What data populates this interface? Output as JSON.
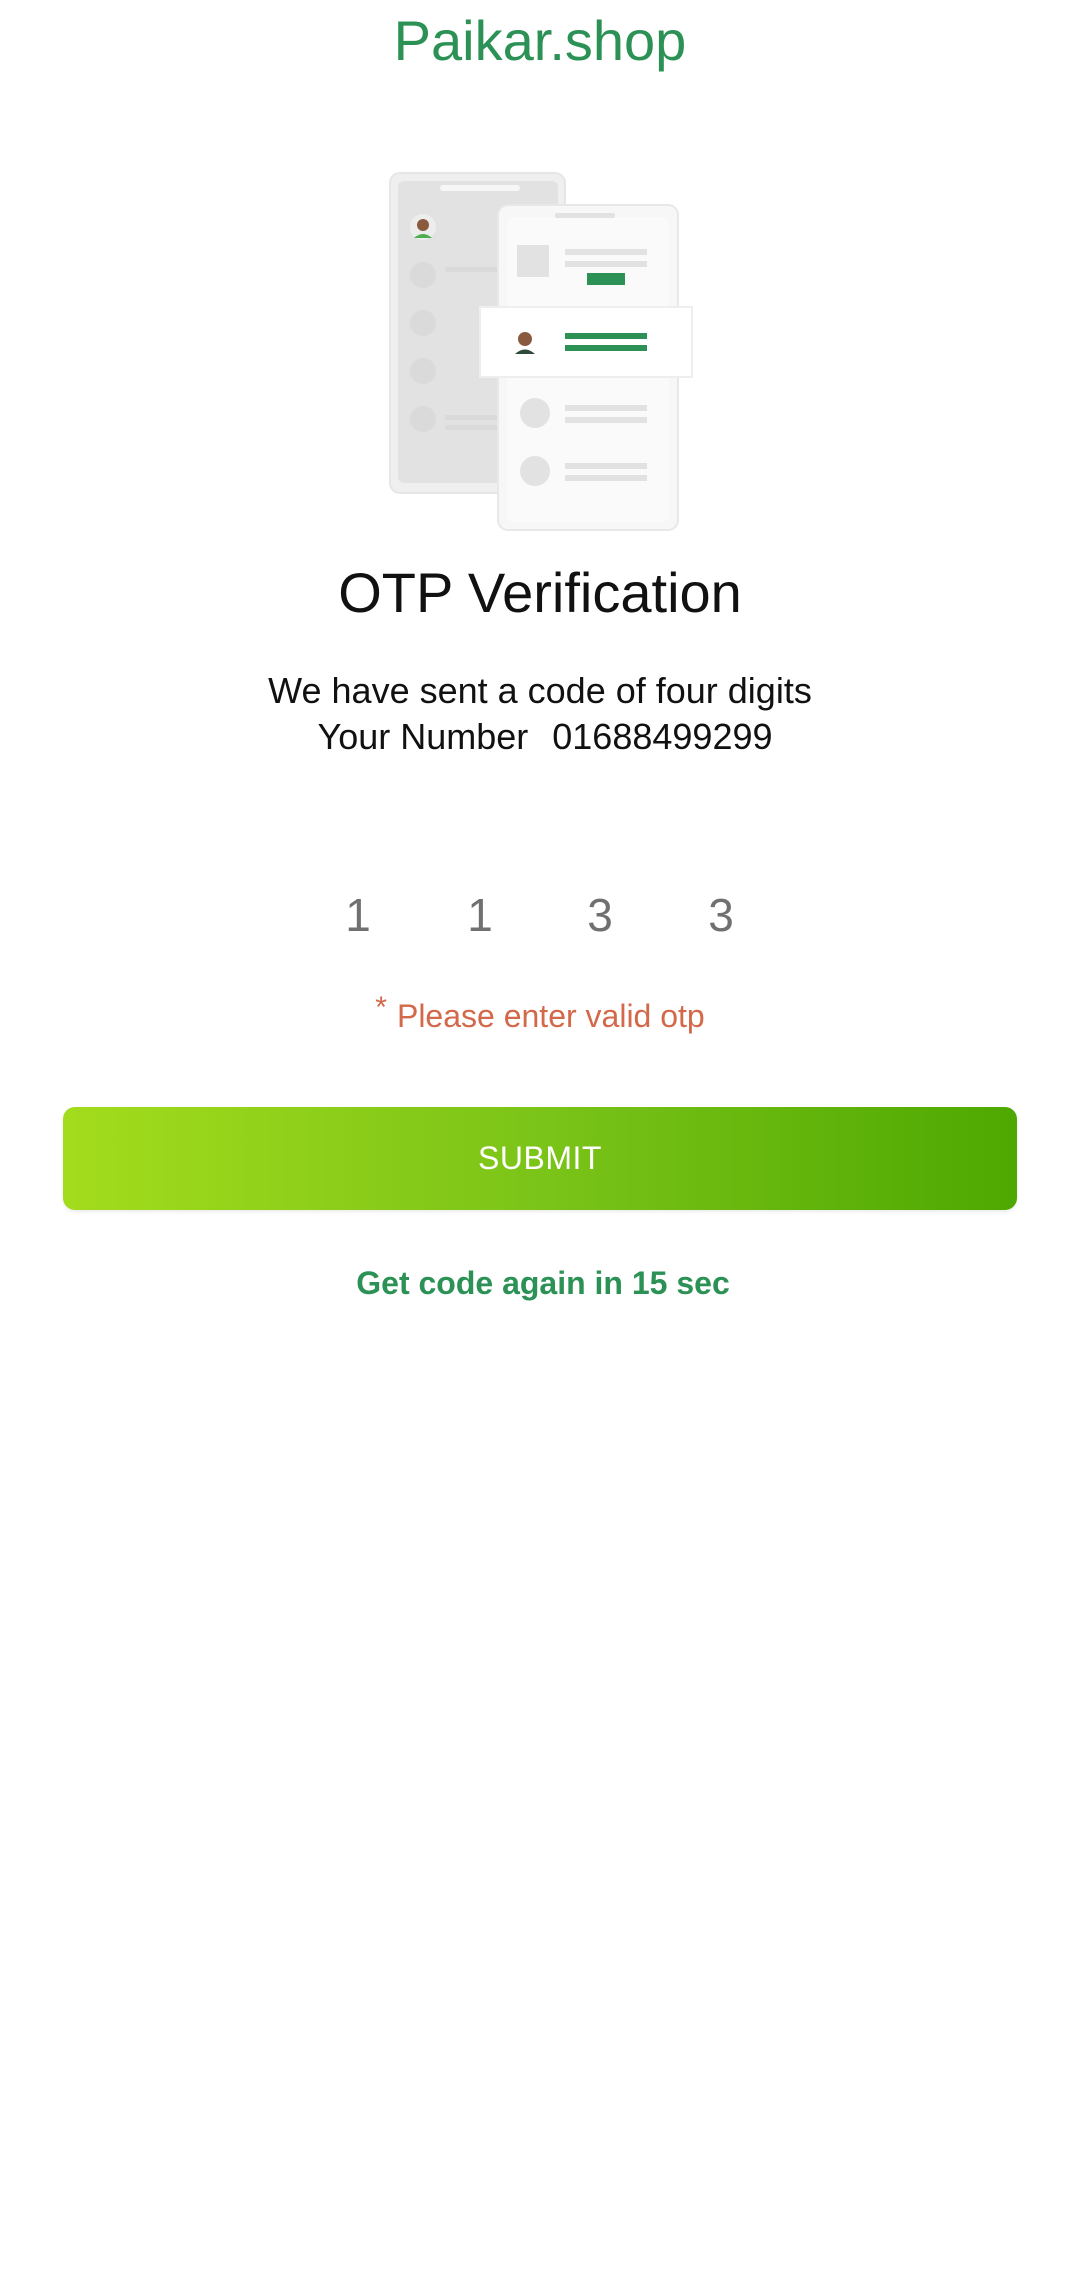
{
  "header": {
    "brand": "Paikar.shop"
  },
  "illustration": {
    "icon": "phone-otp-illustration",
    "accent_color": "#2b9155"
  },
  "main": {
    "title": "OTP Verification",
    "message": "We have sent a code of four digits",
    "number_label": "Your Number",
    "phone_number": "01688499299"
  },
  "otp": {
    "digits": [
      "1",
      "1",
      "3",
      "3"
    ]
  },
  "error": {
    "marker": "*",
    "text": "Please enter valid otp",
    "color": "#d3694a"
  },
  "actions": {
    "submit_label": "SUBMIT",
    "resend_text": "Get code again in 15 sec"
  },
  "colors": {
    "brand": "#2b9155",
    "button_start": "#a3dc1c",
    "button_end": "#4ea800"
  }
}
